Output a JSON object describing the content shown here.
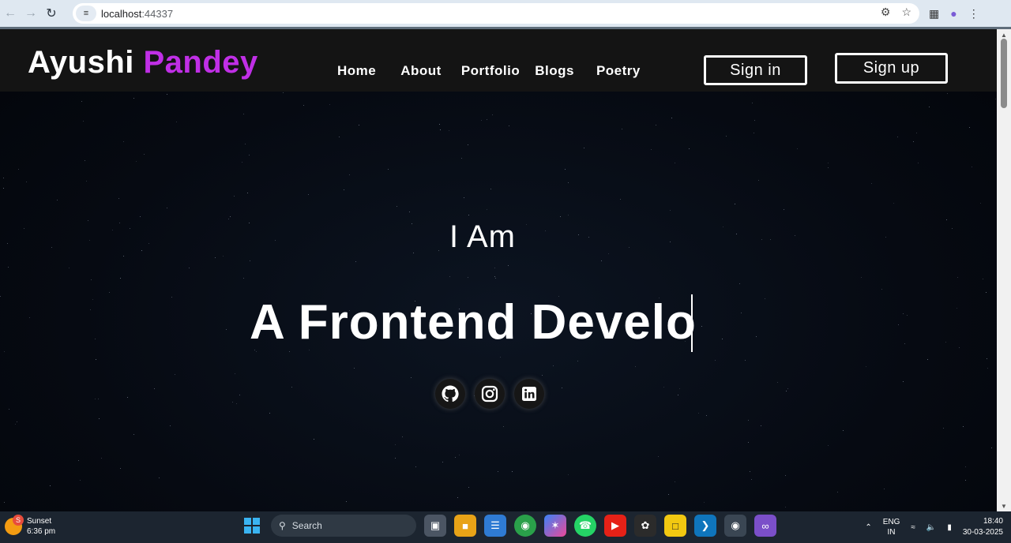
{
  "browser": {
    "url_host": "localhost",
    "url_port": ":44337"
  },
  "site": {
    "logo_first": "Ayushi",
    "logo_second": "Pandey",
    "nav": [
      "Home",
      "About",
      "Portfolio",
      "Blogs",
      "Poetry"
    ],
    "signin_label": "Sign in",
    "signup_label": "Sign up"
  },
  "hero": {
    "intro": "I Am",
    "headline": "A Frontend Develo",
    "socials": [
      "github-icon",
      "instagram-icon",
      "linkedin-icon"
    ]
  },
  "colors": {
    "accent": "#c02fe6",
    "header_bg": "#141414",
    "page_bg": "#060a12"
  },
  "taskbar": {
    "weather_title": "Sunset",
    "weather_time": "6:36 pm",
    "weather_badge": "S",
    "search_label": "Search",
    "lang_top": "ENG",
    "lang_bottom": "IN",
    "time": "18:40",
    "date": "30-03-2025"
  }
}
